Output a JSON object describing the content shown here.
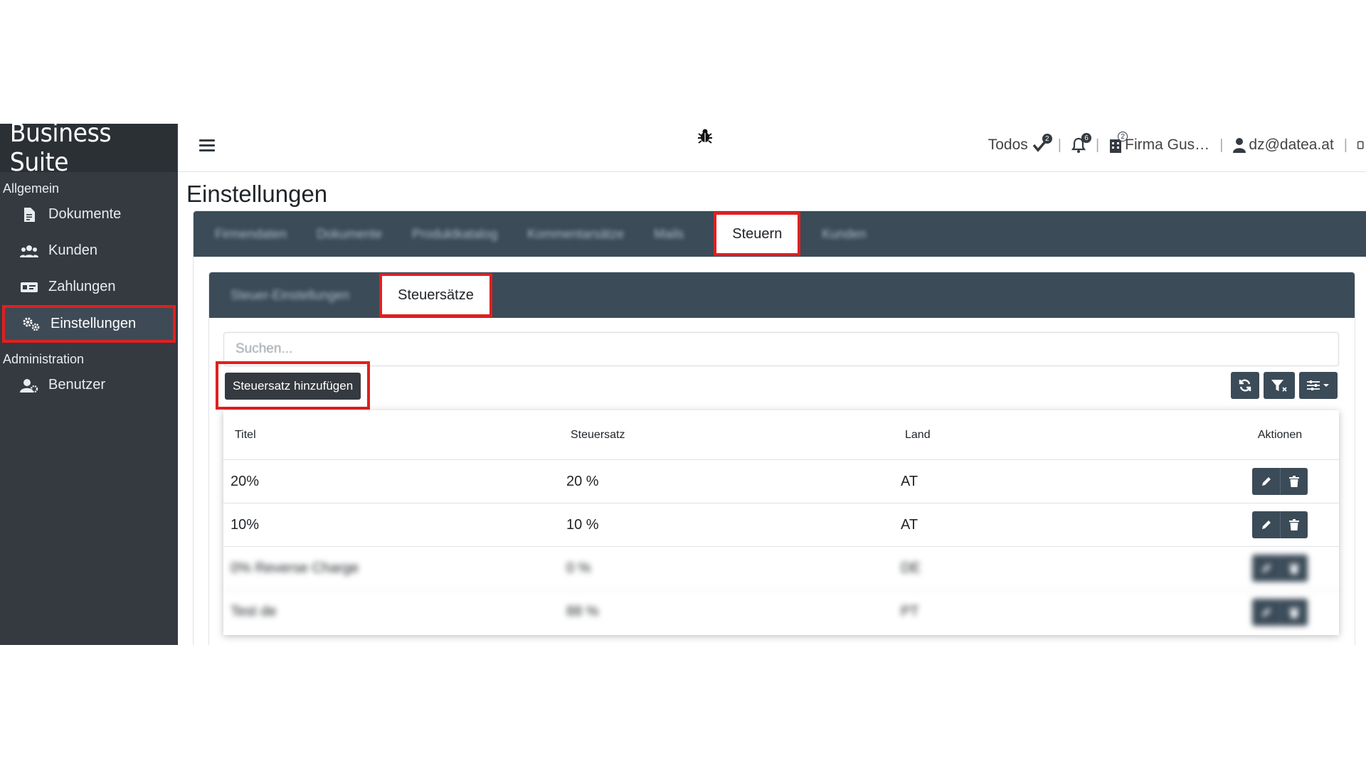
{
  "app": {
    "brand": "Business Suite"
  },
  "sidebar": {
    "sections": [
      {
        "label": "Allgemein"
      },
      {
        "label": "Administration"
      }
    ],
    "items": [
      {
        "label": "Dokumente",
        "icon": "document-icon"
      },
      {
        "label": "Kunden",
        "icon": "users-icon"
      },
      {
        "label": "Zahlungen",
        "icon": "money-icon"
      },
      {
        "label": "Einstellungen",
        "icon": "gears-icon",
        "active": true
      },
      {
        "label": "Benutzer",
        "icon": "user-gear-icon"
      }
    ]
  },
  "topbar": {
    "todos_label": "Todos",
    "todos_badge": "2",
    "notifications_badge": "6",
    "company_badge": "2",
    "company_name": "Firma Gus…",
    "user_email": "dz@datea.at"
  },
  "page": {
    "title": "Einstellungen"
  },
  "tabs_main": {
    "blurred": [
      "Firmendaten",
      "Dokumente",
      "Produktkatalog",
      "Kommentarsätze",
      "Mails"
    ],
    "active": "Steuern",
    "after": [
      "Kunden"
    ]
  },
  "tabs_sub": {
    "blurred": [
      "Steuer-Einstellungen"
    ],
    "active": "Steuersätze"
  },
  "search": {
    "placeholder": "Suchen..."
  },
  "add_button": "Steuersatz hinzufügen",
  "table": {
    "headers": [
      "Titel",
      "Steuersatz",
      "Land",
      "Aktionen"
    ],
    "rows": [
      {
        "titel": "20%",
        "satz": "20 %",
        "land": "AT"
      },
      {
        "titel": "10%",
        "satz": "10 %",
        "land": "AT"
      },
      {
        "titel": "0% Reverse Charge",
        "satz": "0 %",
        "land": "DE"
      },
      {
        "titel": "Test de",
        "satz": "88 %",
        "land": "PT"
      }
    ]
  },
  "colors": {
    "sidebar": "#343a40",
    "tabbar": "#3b4b58",
    "highlight": "#e02020"
  }
}
